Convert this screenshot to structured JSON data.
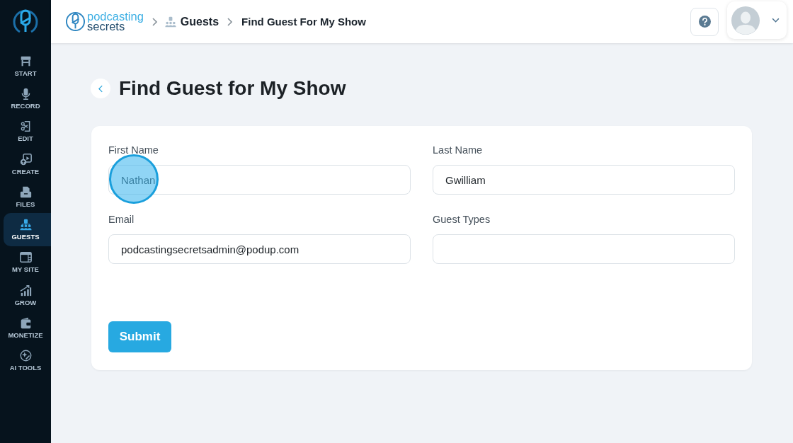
{
  "sidebar": {
    "items": [
      {
        "label": "START",
        "selected": false
      },
      {
        "label": "RECORD",
        "selected": false
      },
      {
        "label": "EDIT",
        "selected": false
      },
      {
        "label": "CREATE",
        "selected": false
      },
      {
        "label": "FILES",
        "selected": false
      },
      {
        "label": "GUESTS",
        "selected": true
      },
      {
        "label": "MY SITE",
        "selected": false
      },
      {
        "label": "GROW",
        "selected": false
      },
      {
        "label": "MONETIZE",
        "selected": false
      },
      {
        "label": "AI TOOLS",
        "selected": false
      }
    ]
  },
  "header": {
    "logo": {
      "line_1": "podcasting",
      "line_2": "secrets"
    },
    "breadcrumb": [
      {
        "label": "Guests"
      },
      {
        "label": "Find Guest For My Show"
      }
    ]
  },
  "page": {
    "title": "Find Guest for My Show"
  },
  "form": {
    "fields": [
      {
        "label": "First Name",
        "value": "Nathan",
        "highlighted": true
      },
      {
        "label": "Last Name",
        "value": "Gwilliam",
        "highlighted": false
      },
      {
        "label": "Email",
        "value": "podcastingsecretsadmin@podup.com",
        "highlighted": false
      },
      {
        "label": "Guest Types",
        "highlighted": false
      }
    ],
    "submit": "Submit"
  }
}
